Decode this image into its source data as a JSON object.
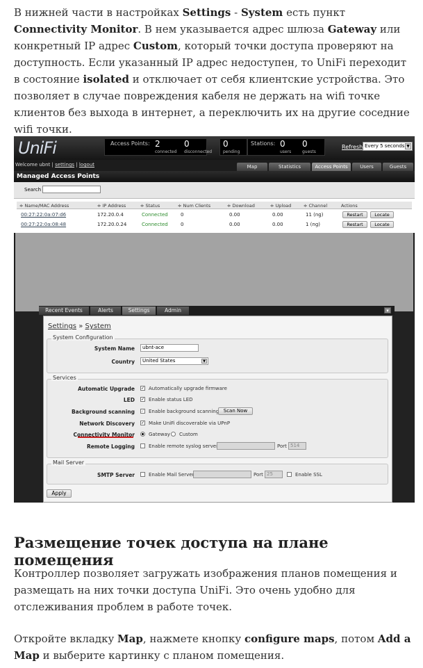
{
  "article": {
    "p1": {
      "t1": "В нижней части в настройках ",
      "b1": "Settings",
      "t2": " - ",
      "b2": "System",
      "t3": " есть пункт ",
      "b3": "Connectivity Monitor",
      "t4": ". В нем указывается адрес шлюза ",
      "b4": "Gateway",
      "t5": " или конкретный IP адрес ",
      "b5": "Custom",
      "t6": ", который точки доступа проверяют на доступность. Если указанный IP адрес недоступен, то UniFi переходит в состояние ",
      "b6": "isolated",
      "t7": " и отключает от себя клиентские устройства. Это позволяет в случае повреждения кабеля не держать на wifi точке клиентов без выхода в интернет, а переключить их на другие соседние wifi точки."
    },
    "heading": "Размещение точек доступа на плане помещения",
    "p2": "Контроллер позволяет загружать изображения планов помещения и размещать на них точки доступа UniFi. Это очень удобно для отслеживания проблем в работе точек.",
    "p3": {
      "t1": "Откройте вкладку ",
      "b1": "Map",
      "t2": ", нажмете кнопку ",
      "b2": "configure maps",
      "t3": ", потом ",
      "b3": "Add a Map",
      "t4": " и выберите картинку с планом помещения."
    }
  },
  "unifi": {
    "logo": "UniFi",
    "stats": {
      "ap_label": "Access Points:",
      "connected": "2",
      "connected_label": "connected",
      "disconnected": "0",
      "disconnected_label": "disconnected",
      "pending": "0",
      "pending_label": "pending",
      "stations_label": "Stations:",
      "users": "0",
      "users_label": "users",
      "guests": "0",
      "guests_label": "guests"
    },
    "refresh_label": "Refresh",
    "refresh_value": "Every 5 seconds",
    "welcome": "Welcome ubnt |",
    "settings_link": "settings",
    "logout_link": "logout",
    "tabs": [
      "Map",
      "Statistics",
      "Access Points",
      "Users",
      "Guests"
    ],
    "managed_title": "Managed Access Points",
    "search_label": "Search",
    "columns": [
      "≑ Name/MAC Address",
      "≑ IP Address",
      "≑ Status",
      "≑ Num Clients",
      "≑ Download",
      "≑ Upload",
      "≑ Channel",
      "Actions"
    ],
    "rows": [
      {
        "mac": "00:27:22:0a:07:d6",
        "ip": "172.20.0.4",
        "status": "Connected",
        "clients": "0",
        "download": "0.00",
        "upload": "0.00",
        "channel": "11 (ng)"
      },
      {
        "mac": "00:27:22:0a:08:48",
        "ip": "172.20.0.24",
        "status": "Connected",
        "clients": "0",
        "download": "0.00",
        "upload": "0.00",
        "channel": "1 (ng)"
      }
    ],
    "restart_label": "Restart",
    "locate_label": "Locate",
    "panel_tabs": [
      "Recent Events",
      "Alerts",
      "Settings",
      "Admin"
    ],
    "breadcrumb_settings": "Settings",
    "breadcrumb_sep": " » ",
    "breadcrumb_system": "System",
    "sysconf": {
      "title": "System Configuration",
      "name_label": "System Name",
      "name_value": "ubnt-ace",
      "country_label": "Country",
      "country_value": "United States"
    },
    "services": {
      "title": "Services",
      "auto_upgrade_label": "Automatic Upgrade",
      "auto_upgrade_text": "Automatically upgrade firmware",
      "led_label": "LED",
      "led_text": "Enable status LED",
      "bg_scan_label": "Background scanning",
      "bg_scan_text": "Enable background scanning",
      "scan_now": "Scan Now",
      "net_disc_label": "Network Discovery",
      "net_disc_text": "Make UniFi discoverable via UPnP",
      "conn_mon_label": "Connectivity Monitor",
      "gateway_text": "Gateway",
      "custom_text": "Custom",
      "remote_log_label": "Remote Logging",
      "remote_log_text": "Enable remote syslog server",
      "port_label": "Port",
      "port_value": "514"
    },
    "mail": {
      "title": "Mail Server",
      "smtp_label": "SMTP Server",
      "smtp_text": "Enable Mail Server",
      "port_label": "Port",
      "port_value": "25",
      "ssl_text": "Enable SSL"
    },
    "apply": "Apply"
  },
  "colors": {
    "accent_red": "#c81e1e",
    "connected_green": "#2d8c2d"
  }
}
